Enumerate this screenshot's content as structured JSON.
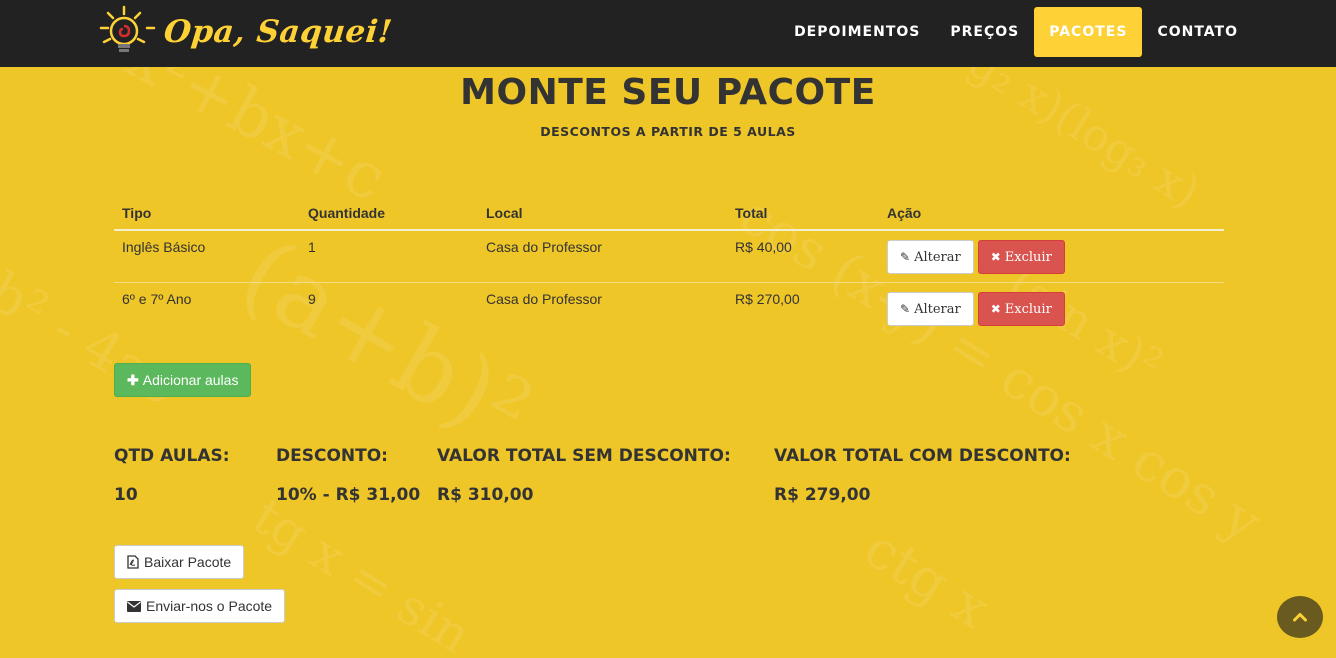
{
  "brand": {
    "name": "Opa, Saquei!"
  },
  "nav": {
    "items": [
      {
        "label": "DEPOIMENTOS"
      },
      {
        "label": "PREÇOS"
      },
      {
        "label": "PACOTES"
      },
      {
        "label": "CONTATO"
      }
    ],
    "active": "PACOTES"
  },
  "header": {
    "title": "MONTE SEU PACOTE",
    "subtitle": "DESCONTOS A PARTIR DE 5 AULAS"
  },
  "table": {
    "headers": [
      "Tipo",
      "Quantidade",
      "Local",
      "Total",
      "Ação"
    ],
    "rows": [
      {
        "tipo": "Inglês Básico",
        "quantidade": "1",
        "local": "Casa do Professor",
        "total": "R$ 40,00"
      },
      {
        "tipo": "6º e 7º Ano",
        "quantidade": "9",
        "local": "Casa do Professor",
        "total": "R$ 270,00"
      }
    ],
    "alter_label": "Alterar",
    "delete_label": "Excluir"
  },
  "add_button": {
    "label": "Adicionar aulas"
  },
  "summary": {
    "qtd_label": "QTD AULAS:",
    "qtd_value": "10",
    "desconto_label": "DESCONTO:",
    "desconto_value": "10% - R$ 31,00",
    "sem_label": "VALOR TOTAL SEM DESCONTO:",
    "sem_value": "R$ 310,00",
    "com_label": "VALOR TOTAL COM DESCONTO:",
    "com_value": "R$ 279,00"
  },
  "actions": {
    "download_label": "Baixar Pacote",
    "send_label": "Enviar-nos o Pacote"
  },
  "icons": {
    "logo": "lightbulb-icon",
    "alter": "pencil-icon",
    "delete": "times-icon",
    "add": "plus-icon",
    "download": "pdf-file-icon",
    "send": "envelope-icon",
    "scroll_top": "chevron-up-icon"
  },
  "colors": {
    "navbar": "#222222",
    "accent": "#fed136",
    "background": "#efc628",
    "danger": "#d9534f",
    "success": "#5cb85c"
  }
}
